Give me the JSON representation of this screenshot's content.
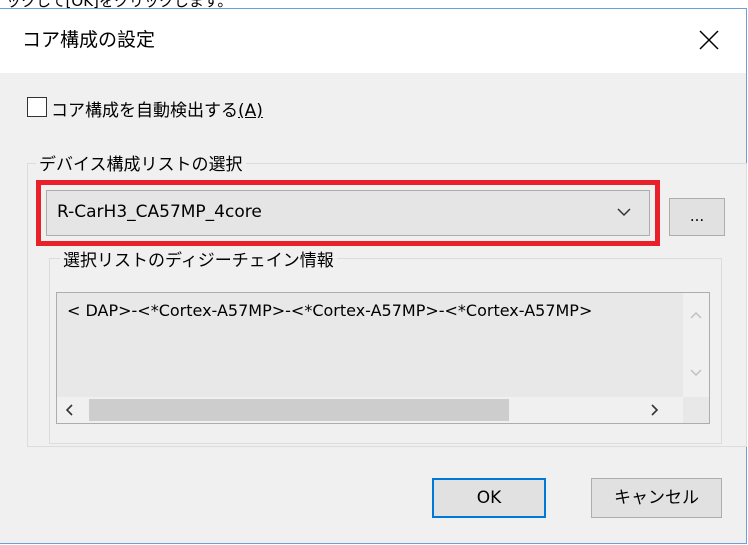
{
  "top_strip_text": "ックして[OK]をクリックします。",
  "dialog": {
    "title": "コア構成の設定",
    "auto_detect": {
      "label": "コア構成を自動検出する",
      "accelerator": "(A)",
      "checked": false
    },
    "device_group": {
      "label": "デバイス構成リストの選択",
      "selected_value": "R-CarH3_CA57MP_4core",
      "browse_label": "..."
    },
    "chain_group": {
      "label": "選択リストのディジーチェイン情報",
      "text": "< DAP>-<*Cortex-A57MP>-<*Cortex-A57MP>-<*Cortex-A57MP>"
    },
    "buttons": {
      "ok": "OK",
      "cancel": "キャンセル"
    }
  },
  "colors": {
    "highlight": "#e8202a",
    "default_button_border": "#0078d7",
    "window_border": "#6aa0d8"
  }
}
